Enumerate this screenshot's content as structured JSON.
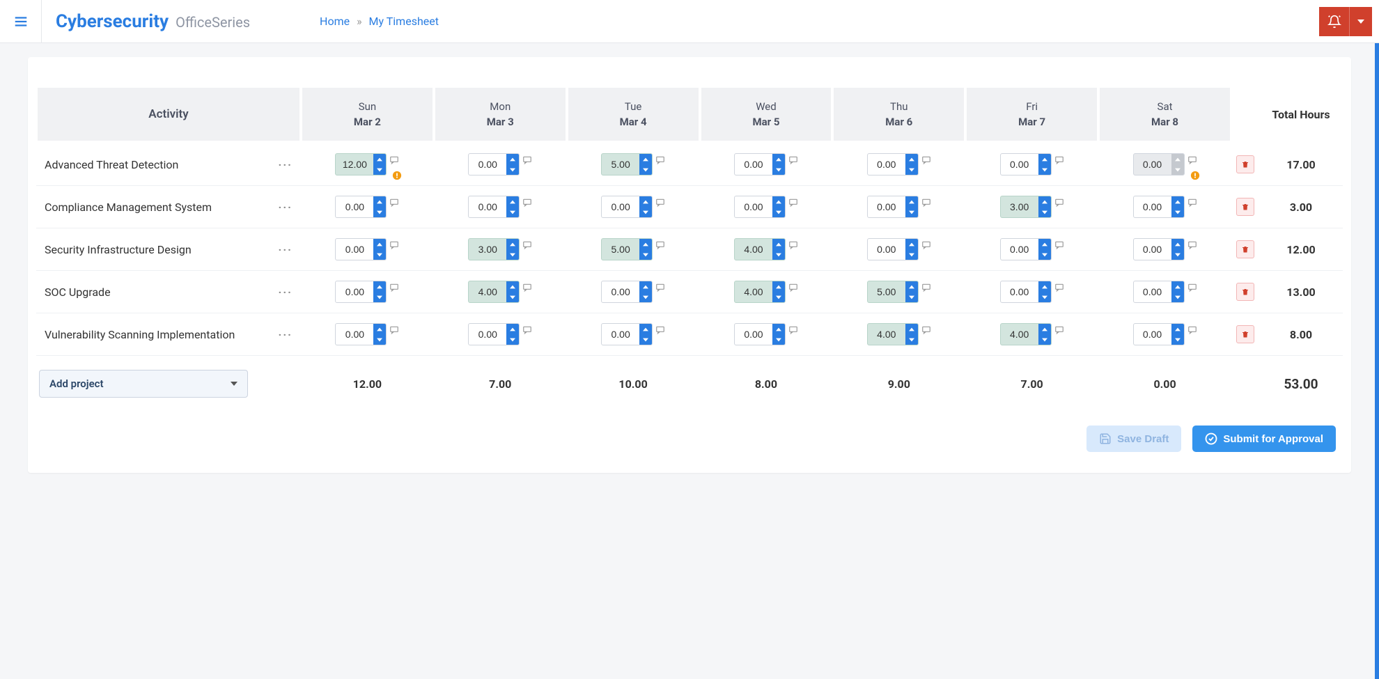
{
  "brand": {
    "main": "Cybersecurity",
    "sub": "OfficeSeries"
  },
  "breadcrumb": {
    "home": "Home",
    "current": "My Timesheet"
  },
  "table": {
    "activity_header": "Activity",
    "total_header": "Total Hours",
    "days": [
      {
        "dow": "Sun",
        "date": "Mar 2"
      },
      {
        "dow": "Mon",
        "date": "Mar 3"
      },
      {
        "dow": "Tue",
        "date": "Mar 4"
      },
      {
        "dow": "Wed",
        "date": "Mar 5"
      },
      {
        "dow": "Thu",
        "date": "Mar 6"
      },
      {
        "dow": "Fri",
        "date": "Mar 7"
      },
      {
        "dow": "Sat",
        "date": "Mar 8"
      }
    ],
    "rows": [
      {
        "activity": "Advanced Threat Detection",
        "cells": [
          {
            "value": "12.00",
            "filled": true,
            "warn": true
          },
          {
            "value": "0.00"
          },
          {
            "value": "5.00",
            "filled": true
          },
          {
            "value": "0.00"
          },
          {
            "value": "0.00"
          },
          {
            "value": "0.00"
          },
          {
            "value": "0.00",
            "disabled": true,
            "warn": true
          }
        ],
        "total": "17.00"
      },
      {
        "activity": "Compliance Management System",
        "cells": [
          {
            "value": "0.00"
          },
          {
            "value": "0.00"
          },
          {
            "value": "0.00"
          },
          {
            "value": "0.00"
          },
          {
            "value": "0.00"
          },
          {
            "value": "3.00",
            "filled": true
          },
          {
            "value": "0.00"
          }
        ],
        "total": "3.00"
      },
      {
        "activity": "Security Infrastructure Design",
        "cells": [
          {
            "value": "0.00"
          },
          {
            "value": "3.00",
            "filled": true
          },
          {
            "value": "5.00",
            "filled": true
          },
          {
            "value": "4.00",
            "filled": true
          },
          {
            "value": "0.00"
          },
          {
            "value": "0.00"
          },
          {
            "value": "0.00"
          }
        ],
        "total": "12.00"
      },
      {
        "activity": "SOC Upgrade",
        "cells": [
          {
            "value": "0.00"
          },
          {
            "value": "4.00",
            "filled": true
          },
          {
            "value": "0.00"
          },
          {
            "value": "4.00",
            "filled": true
          },
          {
            "value": "5.00",
            "filled": true
          },
          {
            "value": "0.00"
          },
          {
            "value": "0.00"
          }
        ],
        "total": "13.00"
      },
      {
        "activity": "Vulnerability Scanning Implementation",
        "cells": [
          {
            "value": "0.00"
          },
          {
            "value": "0.00"
          },
          {
            "value": "0.00"
          },
          {
            "value": "0.00"
          },
          {
            "value": "4.00",
            "filled": true
          },
          {
            "value": "4.00",
            "filled": true
          },
          {
            "value": "0.00"
          }
        ],
        "total": "8.00"
      }
    ],
    "col_totals": [
      "12.00",
      "7.00",
      "10.00",
      "8.00",
      "9.00",
      "7.00",
      "0.00"
    ],
    "grand_total": "53.00",
    "add_project_label": "Add project"
  },
  "buttons": {
    "save_draft": "Save Draft",
    "submit": "Submit for Approval"
  }
}
